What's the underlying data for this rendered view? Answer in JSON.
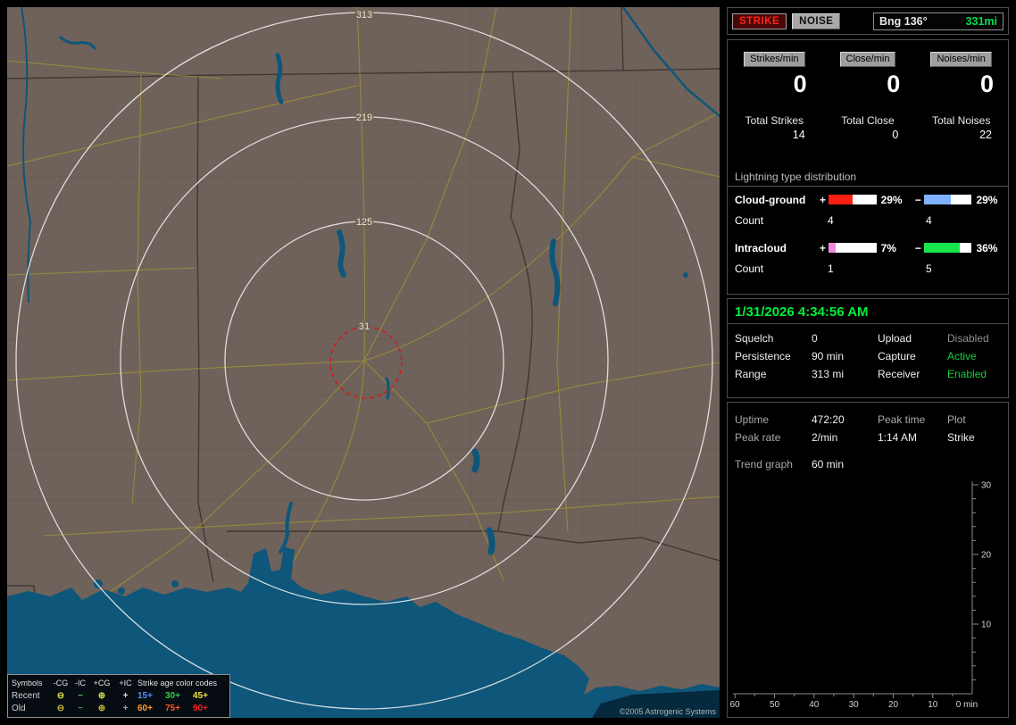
{
  "map": {
    "ring_labels": [
      "313",
      "219",
      "125",
      "31"
    ],
    "copyright": "©2005 Astrogenic Systems",
    "colors": {
      "land": "#6f625b",
      "water": "#0e567a",
      "range_ring": "#eeeeee",
      "alarm_ring": "#e01010",
      "road": "#a5972f"
    },
    "legend": {
      "symbols_header": "Symbols",
      "col_headers": [
        "-CG",
        "-IC",
        "+CG",
        "+IC"
      ],
      "age_header": "Strike age color codes",
      "rows": [
        {
          "label": "Recent",
          "symbols": [
            {
              "glyph": "⊖",
              "color": "#d8dc50"
            },
            {
              "glyph": "−",
              "color": "#55c35f"
            },
            {
              "glyph": "⊕",
              "color": "#d8dc50"
            },
            {
              "glyph": "+",
              "color": "#e0e0e0"
            }
          ],
          "ages": [
            {
              "label": "15+",
              "color": "#5d8bff"
            },
            {
              "label": "30+",
              "color": "#2fcf4a"
            },
            {
              "label": "45+",
              "color": "#f5e23c"
            }
          ]
        },
        {
          "label": "Old",
          "symbols": [
            {
              "glyph": "⊖",
              "color": "#c4b33a"
            },
            {
              "glyph": "−",
              "color": "#3f9a47"
            },
            {
              "glyph": "⊕",
              "color": "#c4b33a"
            },
            {
              "glyph": "+",
              "color": "#a8a8a8"
            }
          ],
          "ages": [
            {
              "label": "60+",
              "color": "#ff9a30"
            },
            {
              "label": "75+",
              "color": "#ff5722"
            },
            {
              "label": "90+",
              "color": "#ff1f1f"
            }
          ]
        }
      ]
    }
  },
  "panel": {
    "strike_btn": "STRIKE",
    "noise_btn": "NOISE",
    "bearing": "Bng 136°",
    "distance": "331mi",
    "rate_labels": [
      "Strikes/min",
      "Close/min",
      "Noises/min"
    ],
    "rates": [
      "0",
      "0",
      "0"
    ],
    "total_labels": [
      "Total Strikes",
      "Total Close",
      "Total Noises"
    ],
    "totals": [
      "14",
      "0",
      "22"
    ],
    "dist_title": "Lightning type distribution",
    "plus_sign": "+",
    "minus_sign": "−",
    "count_label": "Count",
    "cloud_ground": {
      "label": "Cloud-ground",
      "plus_pct": "29%",
      "minus_pct": "29%",
      "plus_fill": "50%",
      "minus_fill": "57%",
      "plus_color": "#ff1e14",
      "minus_color": "#7fb2ff",
      "plus_count": "4",
      "minus_count": "4"
    },
    "intracloud": {
      "label": "Intracloud",
      "plus_pct": "7%",
      "minus_pct": "36%",
      "plus_fill": "15%",
      "minus_fill": "75%",
      "plus_color": "#f08ae0",
      "minus_color": "#17e54a",
      "plus_count": "1",
      "minus_count": "5"
    },
    "datetime": "1/31/2026 4:34:56 AM",
    "status_rows": [
      {
        "k1": "Squelch",
        "v1": "0",
        "k2": "Upload",
        "v2": "Disabled",
        "v2_color": "#8f8f8f"
      },
      {
        "k1": "Persistence",
        "v1": "90 min",
        "k2": "Capture",
        "v2": "Active",
        "v2_color": "#15cf3c"
      },
      {
        "k1": "Range",
        "v1": "313 mi",
        "k2": "Receiver",
        "v2": "Enabled",
        "v2_color": "#15cf3c"
      }
    ],
    "info_rows": [
      {
        "c1": "Uptime",
        "c2": "472:20",
        "c3": "Peak time",
        "c4": "Plot"
      },
      {
        "c1": "Peak rate",
        "c2": "2/min",
        "c3": "1:14 AM",
        "c4": "Strike"
      }
    ],
    "trend_label": "Trend graph",
    "trend_window": "60 min",
    "graph": {
      "y_ticks": [
        "30",
        "20",
        "10"
      ],
      "x_ticks": [
        "60",
        "50",
        "40",
        "30",
        "20",
        "10",
        "0 min"
      ]
    }
  }
}
